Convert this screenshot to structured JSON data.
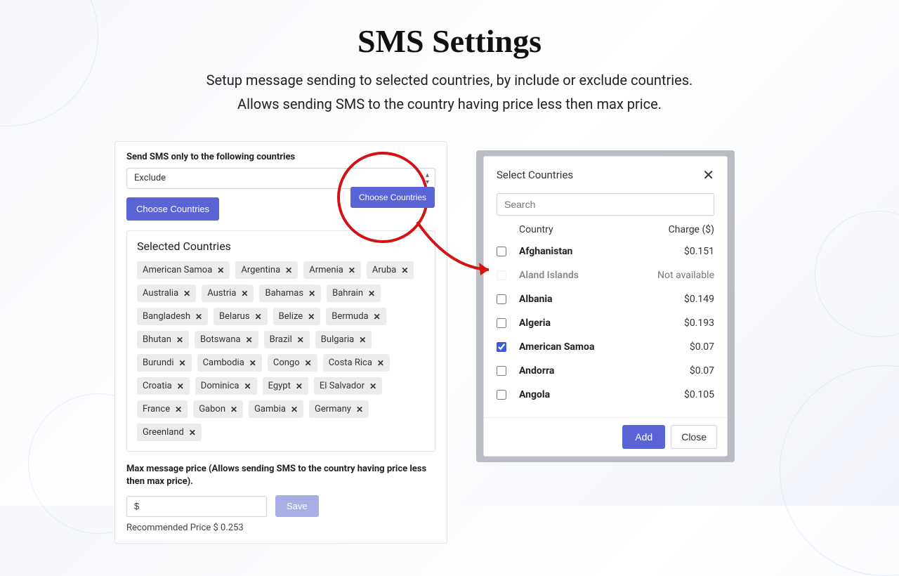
{
  "heading": "SMS Settings",
  "subhead_line1": "Setup message sending to selected countries, by include or exclude countries.",
  "subhead_line2": "Allows sending SMS to the country having price less then max price.",
  "left": {
    "label_mode": "Send SMS only to the following countries",
    "mode_value": "Exclude",
    "choose_btn": "Choose Countries",
    "selected_title": "Selected Countries",
    "tags": [
      "American Samoa",
      "Argentina",
      "Armenia",
      "Aruba",
      "Australia",
      "Austria",
      "Bahamas",
      "Bahrain",
      "Bangladesh",
      "Belarus",
      "Belize",
      "Bermuda",
      "Bhutan",
      "Botswana",
      "Brazil",
      "Bulgaria",
      "Burundi",
      "Cambodia",
      "Congo",
      "Costa Rica",
      "Croatia",
      "Dominica",
      "Egypt",
      "El Salvador",
      "France",
      "Gabon",
      "Gambia",
      "Germany",
      "Greenland"
    ],
    "max_price_label": "Max message price (Allows sending SMS to the country having price less then max price).",
    "max_price_prefix": "$",
    "save_btn": "Save",
    "recommended": "Recommended Price $ 0.253"
  },
  "highlight": {
    "choose_btn": "Choose Countries"
  },
  "modal": {
    "title": "Select Countries",
    "search_placeholder": "Search",
    "col_country": "Country",
    "col_charge": "Charge ($)",
    "rows": [
      {
        "name": "Afghanistan",
        "charge": "$0.151",
        "checked": false,
        "disabled": false
      },
      {
        "name": "Aland Islands",
        "charge": "Not available",
        "checked": false,
        "disabled": true
      },
      {
        "name": "Albania",
        "charge": "$0.149",
        "checked": false,
        "disabled": false
      },
      {
        "name": "Algeria",
        "charge": "$0.193",
        "checked": false,
        "disabled": false
      },
      {
        "name": "American Samoa",
        "charge": "$0.07",
        "checked": true,
        "disabled": false
      },
      {
        "name": "Andorra",
        "charge": "$0.07",
        "checked": false,
        "disabled": false
      },
      {
        "name": "Angola",
        "charge": "$0.105",
        "checked": false,
        "disabled": false
      }
    ],
    "add_btn": "Add",
    "close_btn": "Close"
  }
}
